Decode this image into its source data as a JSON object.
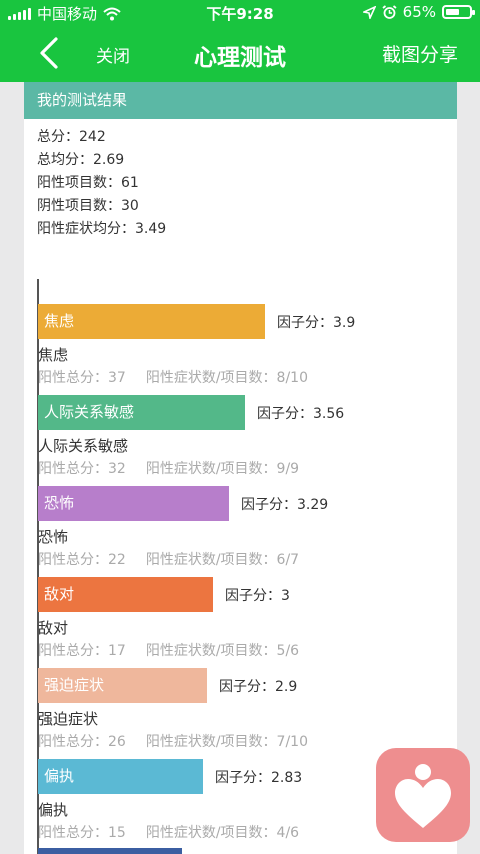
{
  "status_bar": {
    "carrier": "中国移动",
    "time": "下午9:28",
    "battery": "65%"
  },
  "nav": {
    "close_label": "关闭",
    "title": "心理测试",
    "share_label": "截图分享"
  },
  "card": {
    "header": "我的测试结果",
    "summary": [
      "总分：242",
      "总均分：2.69",
      "阳性项目数：61",
      "阴性项目数：30",
      "阳性症状均分：3.49"
    ]
  },
  "chart_data": {
    "type": "bar",
    "orientation": "horizontal",
    "categories": [
      "焦虑",
      "人际关系敏感",
      "恐怖",
      "敌对",
      "强迫症状",
      "偏执"
    ],
    "values": [
      3.9,
      3.56,
      3.29,
      3,
      2.9,
      2.83
    ],
    "colors": [
      "#ecab36",
      "#53b889",
      "#b77ecb",
      "#ec7540",
      "#efb79c",
      "#5bb9d4"
    ],
    "series": [
      {
        "label": "焦虑",
        "score_text": "因子分：3.9",
        "detail_pos": "阳性总分：37",
        "detail_ratio": "阳性症状数/项目数：8/10"
      },
      {
        "label": "人际关系敏感",
        "score_text": "因子分：3.56",
        "detail_pos": "阳性总分：32",
        "detail_ratio": "阳性症状数/项目数：9/9"
      },
      {
        "label": "恐怖",
        "score_text": "因子分：3.29",
        "detail_pos": "阳性总分：22",
        "detail_ratio": "阳性症状数/项目数：6/7"
      },
      {
        "label": "敌对",
        "score_text": "因子分：3",
        "detail_pos": "阳性总分：17",
        "detail_ratio": "阳性症状数/项目数：5/6"
      },
      {
        "label": "强迫症状",
        "score_text": "因子分：2.9",
        "detail_pos": "阳性总分：26",
        "detail_ratio": "阳性症状数/项目数：7/10"
      },
      {
        "label": "偏执",
        "score_text": "因子分：2.83",
        "detail_pos": "阳性总分：15",
        "detail_ratio": "阳性症状数/项目数：4/6"
      }
    ]
  },
  "colors": {
    "nav_green": "#19c53f",
    "header_teal": "#5bb8a5",
    "float_pink": "#ee8e8f"
  },
  "icons": [
    "signal-icon",
    "wifi-icon",
    "location-icon",
    "alarm-icon",
    "battery-icon",
    "back-chevron-icon",
    "heart-person-icon"
  ]
}
